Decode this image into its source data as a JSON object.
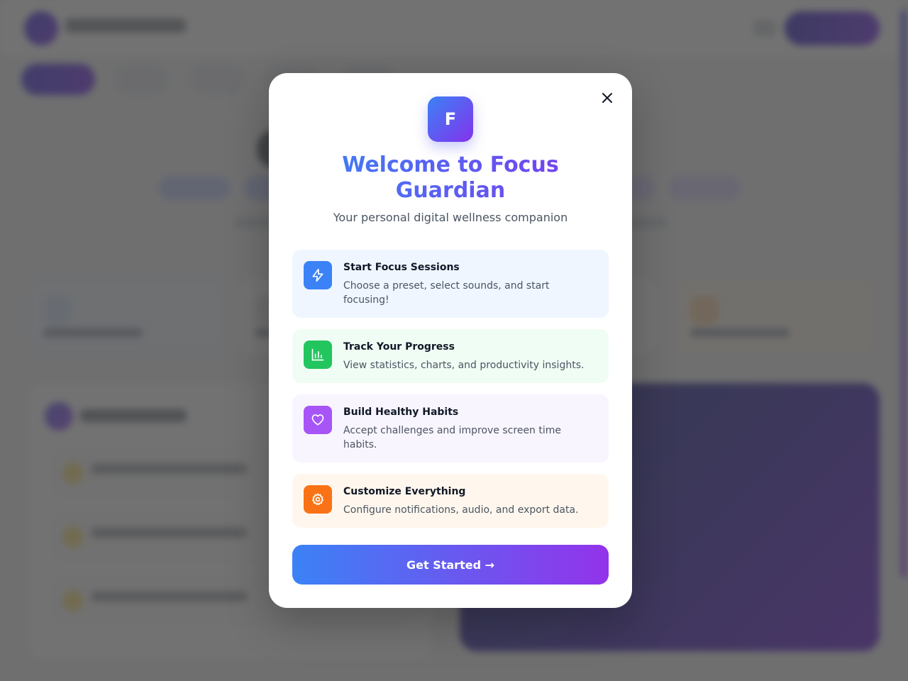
{
  "modal": {
    "app_icon_letter": "F",
    "title": "Welcome to Focus Guardian",
    "subtitle": "Your personal digital wellness companion",
    "close_icon": "close-icon",
    "features": [
      {
        "icon": "lightning-icon",
        "color": "#3b82f6",
        "title": "Start Focus Sessions",
        "description": "Choose a preset, select sounds, and start focusing!"
      },
      {
        "icon": "bar-chart-icon",
        "color": "#22c55e",
        "title": "Track Your Progress",
        "description": "View statistics, charts, and productivity insights."
      },
      {
        "icon": "heart-icon",
        "color": "#a855f7",
        "title": "Build Healthy Habits",
        "description": "Accept challenges and improve screen time habits."
      },
      {
        "icon": "gear-icon",
        "color": "#f97316",
        "title": "Customize Everything",
        "description": "Configure notifications, audio, and export data."
      }
    ],
    "cta_label": "Get Started →"
  },
  "colors": {
    "accent_start": "#3b82f6",
    "accent_end": "#9333ea"
  }
}
